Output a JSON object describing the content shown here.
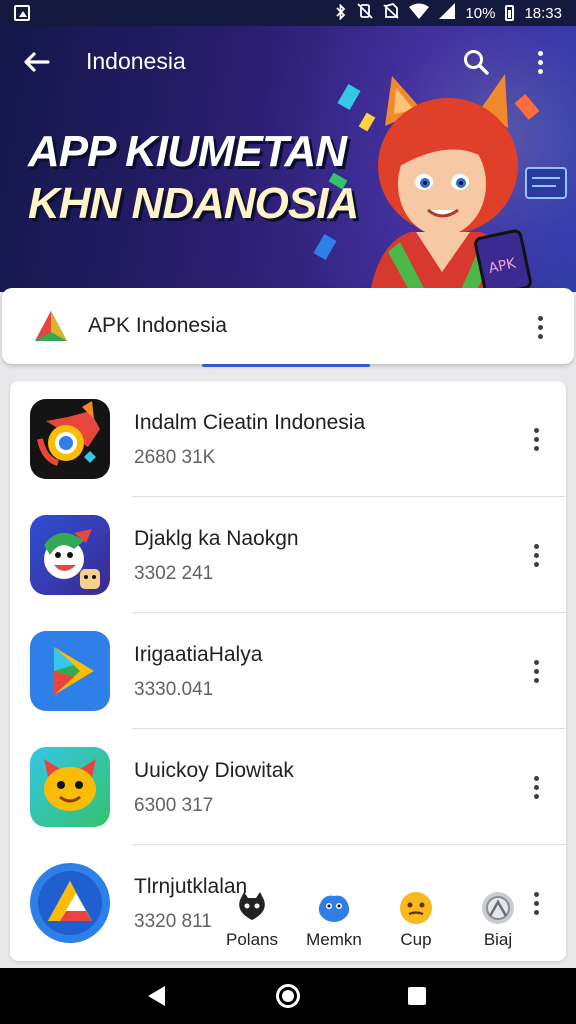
{
  "status_bar": {
    "battery": "10%",
    "time": "18:33",
    "icons": [
      "app-icon",
      "bluetooth-icon",
      "vibrate-icon",
      "no-sim-icon",
      "wifi-icon",
      "signal-icon",
      "battery-icon"
    ]
  },
  "header": {
    "title": "Indonesia",
    "headline_line1": "APP KIUMETAN",
    "headline_line2": "KHN NDANOSIA",
    "mascot_card_text": "APK"
  },
  "featured": {
    "title": "APK Indonesia"
  },
  "apps": [
    {
      "name": "Indalm Cieatin  Indonesia",
      "meta": "2680 31K",
      "icon": "fox-chrome-icon"
    },
    {
      "name": "Djaklg ka Naokgn",
      "meta": "3302 241",
      "icon": "cartoon-character-icon"
    },
    {
      "name": "IrigaatiaHalya",
      "meta": "3330.041",
      "icon": "play-triangle-icon"
    },
    {
      "name": "Uuickoy Diowitak",
      "meta": "6300 317",
      "icon": "yellow-creature-icon"
    },
    {
      "name": "Tlrnjutklalan",
      "meta": "3320 811",
      "icon": "drive-triangle-icon"
    }
  ],
  "mini_tabs": [
    {
      "label": "Polans",
      "icon": "black-cat-icon"
    },
    {
      "label": "Memkn",
      "icon": "blue-monster-icon"
    },
    {
      "label": "Cup",
      "icon": "yellow-face-icon"
    },
    {
      "label": "Biaj",
      "icon": "grey-mascot-icon"
    }
  ],
  "colors": {
    "header_dark": "#12184a",
    "accent_blue": "#2e5fd1",
    "card_bg": "#ffffff",
    "screen_bg": "#e9e9ec"
  }
}
